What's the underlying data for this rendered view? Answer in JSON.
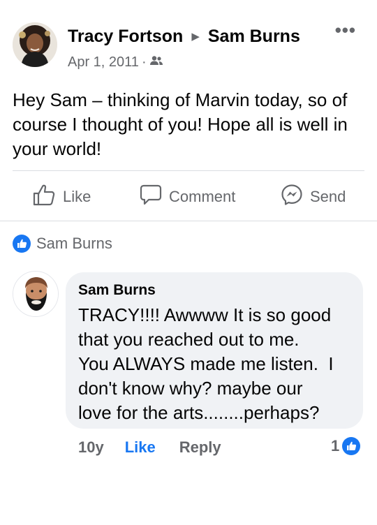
{
  "post": {
    "author": "Tracy Fortson",
    "target": "Sam Burns",
    "date": "Apr 1, 2011",
    "meta_separator": "·",
    "privacy_icon": "friends-icon",
    "more_icon": "more-dots-icon",
    "body": "Hey Sam – thinking of Marvin today, so of course I thought of you! Hope all is well in your world!"
  },
  "actions": {
    "like_label": "Like",
    "comment_label": "Comment",
    "send_label": "Send"
  },
  "reactions": {
    "liked_by": "Sam Burns"
  },
  "comment": {
    "author": "Sam Burns",
    "text_lines": [
      "TRACY!!!! Awwww It is so good",
      "that you reached out to me.",
      "You ALWAYS made me listen.  I",
      "don't know why? maybe our",
      "love for the arts........perhaps?"
    ],
    "time": "10y",
    "like_label": "Like",
    "reply_label": "Reply",
    "reaction_count": "1"
  },
  "colors": {
    "accent": "#1877f2",
    "secondary_text": "#65676b",
    "bubble": "#f0f2f5",
    "divider": "#dadde1"
  }
}
